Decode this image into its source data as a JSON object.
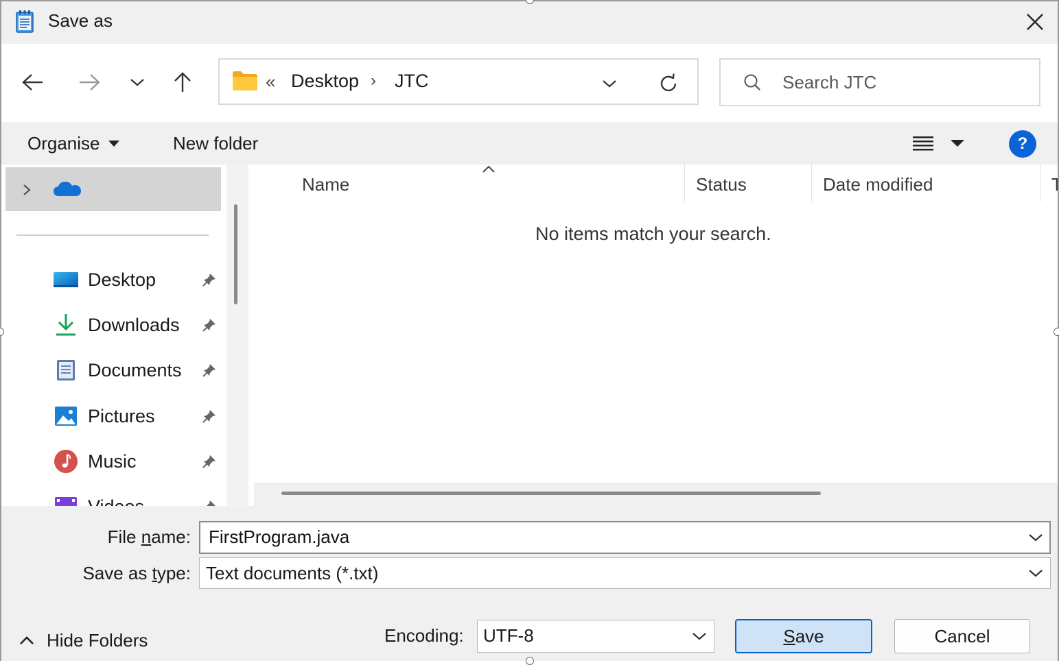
{
  "window": {
    "title": "Save as",
    "icon": "notepad-icon",
    "close_icon": "close-icon"
  },
  "nav": {
    "back_icon": "arrow-left-icon",
    "forward_icon": "arrow-right-icon",
    "recent_icon": "chevron-down-icon",
    "up_icon": "arrow-up-icon",
    "refresh_icon": "refresh-icon"
  },
  "address": {
    "overflow": "«",
    "crumbs": [
      "Desktop",
      "JTC"
    ],
    "separator": "›"
  },
  "search": {
    "placeholder": "Search JTC"
  },
  "toolbar": {
    "organise_label": "Organise",
    "new_folder_label": "New folder",
    "help_label": "?"
  },
  "navpane": {
    "cloud_item": "onedrive-icon",
    "quick_access": [
      {
        "label": "Desktop",
        "icon": "desktop-icon"
      },
      {
        "label": "Downloads",
        "icon": "download-icon"
      },
      {
        "label": "Documents",
        "icon": "documents-icon"
      },
      {
        "label": "Pictures",
        "icon": "pictures-icon"
      },
      {
        "label": "Music",
        "icon": "music-icon"
      },
      {
        "label": "Videos",
        "icon": "videos-icon"
      }
    ]
  },
  "filelist": {
    "columns": [
      "Name",
      "Status",
      "Date modified",
      "T"
    ],
    "empty_message": "No items match your search."
  },
  "form": {
    "file_name_label_pre": "File ",
    "file_name_label_u": "n",
    "file_name_label_post": "ame:",
    "file_name_value": "FirstProgram.java",
    "save_type_label_pre": "Save as ",
    "save_type_label_u": "t",
    "save_type_label_post": "ype:",
    "save_type_value": "Text documents (*.txt)"
  },
  "footer": {
    "hide_folders_label": "Hide Folders",
    "encoding_label": "Encoding:",
    "encoding_value": "UTF-8",
    "save_label_u": "S",
    "save_label_rest": "ave",
    "cancel_label": "Cancel"
  },
  "colors": {
    "accent": "#0a62c8",
    "help": "#0a64d8",
    "folder": "#f5b933",
    "onedrive": "#1470d4"
  }
}
